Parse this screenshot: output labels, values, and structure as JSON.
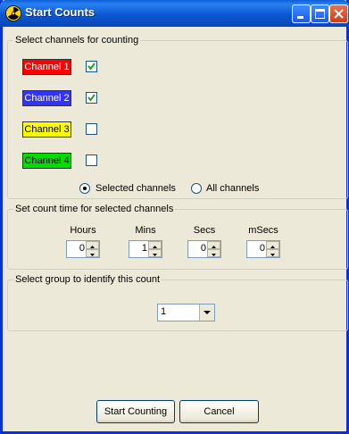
{
  "window": {
    "title": "Start Counts",
    "icon": "radiation-icon",
    "controls": [
      "minimize",
      "maximize",
      "close"
    ]
  },
  "channels_group": {
    "legend": "Select channels for counting",
    "channels": [
      {
        "label": "Channel 1",
        "color": "#ff0000",
        "text_color": "#ffffff",
        "checked": true
      },
      {
        "label": "Channel 2",
        "color": "#3333ff",
        "text_color": "#ffffff",
        "checked": true
      },
      {
        "label": "Channel 3",
        "color": "#ffff00",
        "text_color": "#000000",
        "checked": false
      },
      {
        "label": "Channel 4",
        "color": "#00dd00",
        "text_color": "#000000",
        "checked": false
      }
    ],
    "radio_selected": "Selected channels",
    "radio_all": "All channels",
    "selected_option": "Selected channels"
  },
  "time_group": {
    "legend": "Set count time for selected channels",
    "fields": [
      {
        "label": "Hours",
        "value": "0"
      },
      {
        "label": "Mins",
        "value": "1"
      },
      {
        "label": "Secs",
        "value": "0"
      },
      {
        "label": "mSecs",
        "value": "0"
      }
    ]
  },
  "group_select": {
    "legend": "Select group to identify this count",
    "value": "1"
  },
  "buttons": {
    "start": "Start Counting",
    "cancel": "Cancel"
  }
}
